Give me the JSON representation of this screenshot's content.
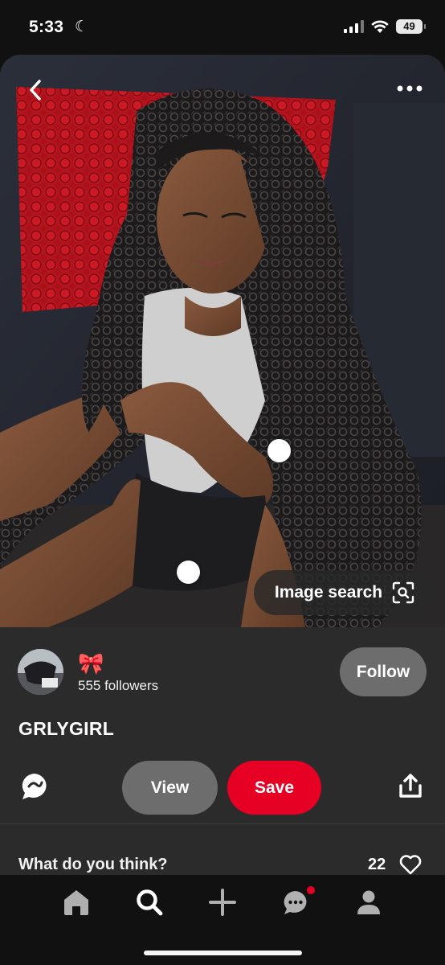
{
  "status_bar": {
    "time": "5:33",
    "moon_icon": "moon-icon",
    "battery": "49"
  },
  "pin": {
    "image_search_label": "Image search",
    "creator": {
      "name": "🎀",
      "followers": "555 followers",
      "follow_label": "Follow"
    },
    "title": "GRLYGIRL",
    "actions": {
      "view_label": "View",
      "save_label": "Save"
    },
    "comments": {
      "prompt": "What do you think?",
      "reaction_count": "22"
    }
  },
  "nav": {
    "items": [
      {
        "icon": "home-icon"
      },
      {
        "icon": "search-icon",
        "active": true
      },
      {
        "icon": "plus-icon"
      },
      {
        "icon": "chat-icon",
        "badge": true
      },
      {
        "icon": "profile-icon"
      }
    ]
  },
  "colors": {
    "accent": "#e60023",
    "button_gray": "#6d6d6d",
    "panel": "#2b2b2b",
    "background": "#111111"
  }
}
